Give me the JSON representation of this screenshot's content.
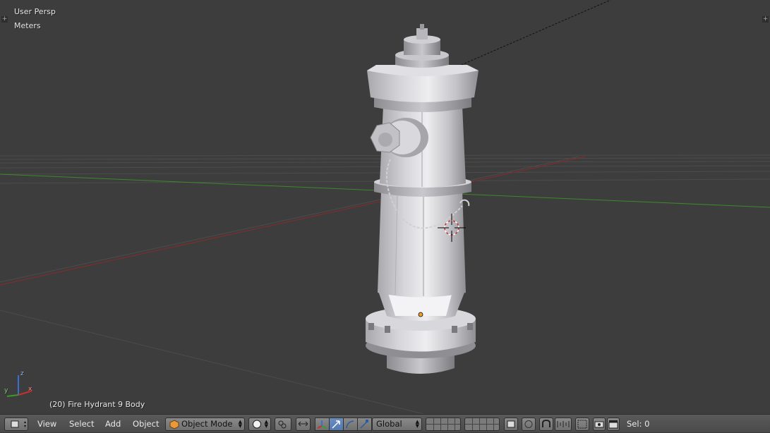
{
  "viewport": {
    "view_name": "User Persp",
    "units": "Meters",
    "object_info": "(20) Fire Hydrant 9 Body",
    "axis_labels": {
      "x": "x",
      "y": "y",
      "z": "z"
    }
  },
  "header": {
    "menus": [
      "View",
      "Select",
      "Add",
      "Object"
    ],
    "mode": "Object Mode",
    "orientation": "Global",
    "selection": "Sel: 0"
  },
  "colors": {
    "x_axis": "#8a2a2a",
    "y_axis": "#3b8a2a",
    "grid": "#4c4c4c",
    "header_bg": "#505050",
    "active_blue": "#5479b0"
  },
  "icons": [
    "editor-type-icon",
    "mode-cube-icon",
    "shading-sphere-icon",
    "pivot-icon",
    "manipulator-icon",
    "translate-icon",
    "rotate-icon",
    "scale-icon",
    "layer-icon",
    "snap-icon",
    "proportional-icon",
    "render-icon",
    "clapboard-icon"
  ]
}
